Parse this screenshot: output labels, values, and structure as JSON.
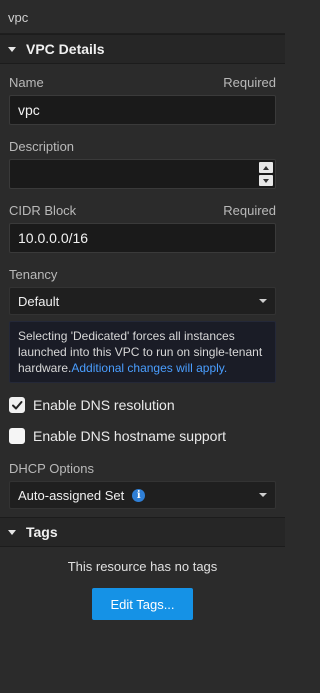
{
  "panel": {
    "title": "vpc"
  },
  "vpc_section": {
    "title": "VPC Details"
  },
  "name_field": {
    "label": "Name",
    "required": "Required",
    "value": "vpc"
  },
  "description_field": {
    "label": "Description",
    "value": ""
  },
  "cidr_field": {
    "label": "CIDR Block",
    "required": "Required",
    "value": "10.0.0.0/16"
  },
  "tenancy_field": {
    "label": "Tenancy",
    "selected": "Default",
    "notice": "Selecting 'Dedicated' forces all instances launched into this VPC to run on single-tenant hardware.",
    "notice_link": "Additional changes will apply."
  },
  "dns_resolution": {
    "label": "Enable DNS resolution",
    "checked": true
  },
  "dns_hostname": {
    "label": "Enable DNS hostname support",
    "checked": false
  },
  "dhcp_field": {
    "label": "DHCP Options",
    "selected": "Auto-assigned Set",
    "info_icon": "i"
  },
  "tags_section": {
    "title": "Tags",
    "empty_text": "This resource has no tags",
    "edit_button": "Edit Tags..."
  },
  "colors": {
    "accent": "#1592e6",
    "link": "#4a9eff",
    "background": "#2b2b2b"
  }
}
